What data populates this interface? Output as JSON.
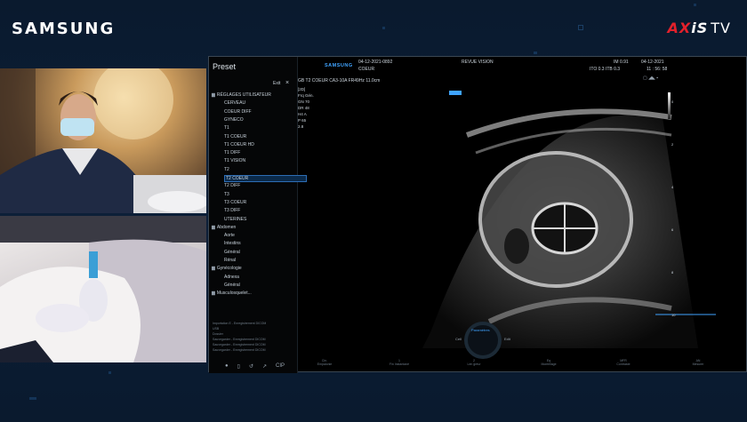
{
  "brand": {
    "left": "SAMSUNG",
    "right_ax": "AX",
    "right_is": "iS",
    "right_tv": "TV"
  },
  "preset": {
    "title": "Preset",
    "exit": "Exit",
    "close": "×",
    "tree": [
      {
        "label": "RÉGLAGES UTILISATEUR",
        "folder": true,
        "indent": 0
      },
      {
        "label": "CERVEAU",
        "indent": 1
      },
      {
        "label": "COEUR DIFF",
        "indent": 1
      },
      {
        "label": "GYNECO",
        "indent": 1
      },
      {
        "label": "T1",
        "indent": 1
      },
      {
        "label": "T1 COEUR",
        "indent": 1
      },
      {
        "label": "T1 COEUR HD",
        "indent": 1
      },
      {
        "label": "T1 DIFF",
        "indent": 1
      },
      {
        "label": "T1 VISION",
        "indent": 1
      },
      {
        "label": "T2",
        "indent": 1
      },
      {
        "label": "T2 COEUR",
        "indent": 1,
        "selected": true
      },
      {
        "label": "T2 DIFF",
        "indent": 1
      },
      {
        "label": "T3",
        "indent": 1
      },
      {
        "label": "T3 COEUR",
        "indent": 1
      },
      {
        "label": "T3 DIFF",
        "indent": 1
      },
      {
        "label": "UTERINES",
        "indent": 1
      },
      {
        "label": "Abdomen",
        "folder": true,
        "indent": 0
      },
      {
        "label": "Aorte",
        "indent": 1
      },
      {
        "label": "Intestins",
        "indent": 1
      },
      {
        "label": "Général",
        "indent": 1
      },
      {
        "label": "Rénal",
        "indent": 1
      },
      {
        "label": "Gynécologie",
        "folder": true,
        "indent": 0
      },
      {
        "label": "Adnexa",
        "indent": 1
      },
      {
        "label": "Général",
        "indent": 1
      },
      {
        "label": "Musculosquelet...",
        "folder": true,
        "indent": 0
      }
    ],
    "mini_list": [
      "Importation E - Enregistrement DICOM",
      "USB",
      "Dossier",
      "Sauvegarder - Enregistrement DICOM",
      "Sauvegarder - Enregistrement DICOM",
      "Sauvegarder - Enregistrement DICOM"
    ],
    "footer_icons": [
      "●",
      "▯",
      "↺",
      "↗",
      "CIP"
    ]
  },
  "header": {
    "samsung_mini": "SAMSUNG",
    "date_code": "04-12-2021-0892",
    "mode_label": "REVUE VISION",
    "exam": "COEUR",
    "probe_line": "GB  T2 COEUR  CA3-10A  FR49Hz  11.0cm",
    "right_vals": "IM  0.91",
    "right_date": "04-12-2021",
    "right_vals2": "ITO 0.3   ITB 0.3",
    "right_time": "11 : 56: 58"
  },
  "params": [
    "[2D]",
    "Frq   Gén.",
    "GN    70",
    "DR    48",
    "H4    A",
    "P     65",
    "2.8"
  ],
  "depth_ticks": [
    "0",
    "2",
    "4",
    "6",
    "8",
    "10"
  ],
  "bottom_bar": [
    "Cin.\nEmpalonie",
    "1\nFin Instantané",
    "2\nLen gréur",
    "Eq\nMontrillage",
    "MFR\nContraste",
    "AN\nMesurer"
  ],
  "dial": {
    "label": "Paramètres",
    "left": "Cell",
    "right": "Edit"
  },
  "colors": {
    "accent": "#3fa3ff",
    "brand_red": "#e3212b",
    "selection": "#2d6db5"
  }
}
